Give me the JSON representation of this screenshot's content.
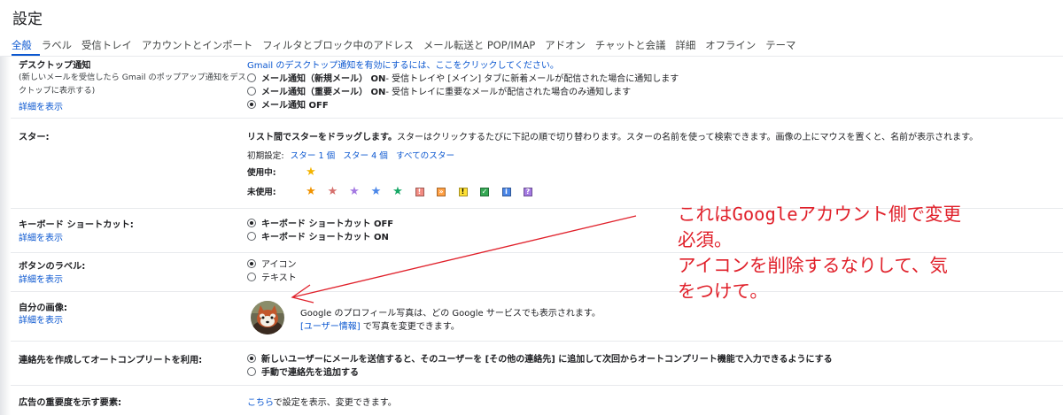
{
  "page": {
    "title": "設定"
  },
  "tabs": [
    "全般",
    "ラベル",
    "受信トレイ",
    "アカウントとインポート",
    "フィルタとブロック中のアドレス",
    "メール転送と POP/IMAP",
    "アドオン",
    "チャットと会議",
    "詳細",
    "オフライン",
    "テーマ"
  ],
  "desktop_notifications": {
    "label": "デスクトップ通知",
    "description": "(新しいメールを受信したら Gmail のポップアップ通知をデスクトップに表示する)",
    "details_link": "詳細を表示",
    "enable_link": "Gmail のデスクトップ通知を有効にするには、ここをクリックしてください。",
    "options": [
      {
        "title": "メール通知（新規メール） ON",
        "desc": " - 受信トレイや [メイン] タブに新着メールが配信された場合に通知します",
        "selected": false
      },
      {
        "title": "メール通知（重要メール） ON",
        "desc": " - 受信トレイに重要なメールが配信された場合のみ通知します",
        "selected": false
      },
      {
        "title": "メール通知 OFF",
        "desc": "",
        "selected": true
      }
    ]
  },
  "stars": {
    "label": "スター:",
    "heading": "リスト間でスターをドラッグします。",
    "description": "スターはクリックするたびに下記の順で切り替わります。スターの名前を使って検索できます。画像の上にマウスを置くと、名前が表示されます。",
    "presets_label": "初期設定:",
    "presets": [
      "スター 1 個",
      "スター 4 個",
      "すべてのスター"
    ],
    "in_use_label": "使用中:",
    "in_use": [
      {
        "glyph": "★",
        "color": "#f4b400"
      }
    ],
    "unused_label": "未使用:",
    "unused_stars": [
      {
        "glyph": "★",
        "color": "#f09300"
      },
      {
        "glyph": "★",
        "color": "#d6706d"
      },
      {
        "glyph": "★",
        "color": "#a479e2"
      },
      {
        "glyph": "★",
        "color": "#4a86e8"
      },
      {
        "glyph": "★",
        "color": "#16a765"
      }
    ],
    "unused_marks": [
      {
        "glyph": "!",
        "bg": "#f28b82",
        "fg": "#ffffff"
      },
      {
        "glyph": "»",
        "bg": "#ff9f43",
        "fg": "#ffffff"
      },
      {
        "glyph": "!",
        "bg": "#ffe135",
        "fg": "#000000"
      },
      {
        "glyph": "✓",
        "bg": "#34a853",
        "fg": "#ffffff"
      },
      {
        "glyph": "i",
        "bg": "#4a86e8",
        "fg": "#ffffff"
      },
      {
        "glyph": "?",
        "bg": "#a479e2",
        "fg": "#ffffff"
      }
    ]
  },
  "keyboard_shortcuts": {
    "label": "キーボード ショートカット:",
    "details_link": "詳細を表示",
    "options": [
      {
        "title": "キーボード ショートカット OFF",
        "selected": true
      },
      {
        "title": "キーボード ショートカット ON",
        "selected": false
      }
    ]
  },
  "button_labels": {
    "label": "ボタンのラベル:",
    "details_link": "詳細を表示",
    "options": [
      {
        "title": "アイコン",
        "selected": true
      },
      {
        "title": "テキスト",
        "selected": false
      }
    ]
  },
  "my_picture": {
    "label": "自分の画像:",
    "details_link": "詳細を表示",
    "line1": "Google のプロフィール写真は、どの Google サービスでも表示されます。",
    "link_text": "[ユーザー情報]",
    "line2_suffix": " で写真を変更できます。"
  },
  "autocomplete": {
    "label": "連絡先を作成してオートコンプリートを利用:",
    "options": [
      {
        "title": "新しいユーザーにメールを送信すると、そのユーザーを [その他の連絡先] に追加して次回からオートコンプリート機能で入力できるようにする",
        "selected": true
      },
      {
        "title": "手動で連絡先を追加する",
        "selected": false
      }
    ]
  },
  "ad_importance": {
    "label": "広告の重要度を示す要素:",
    "link_text": "こちら",
    "suffix": "で設定を表示、変更できます。"
  },
  "annotation": {
    "lines": [
      "これはGoogleアカウント側で変更",
      "必須。",
      "アイコンを削除するなりして、気",
      "をつけて。"
    ],
    "color": "#e0202a"
  }
}
